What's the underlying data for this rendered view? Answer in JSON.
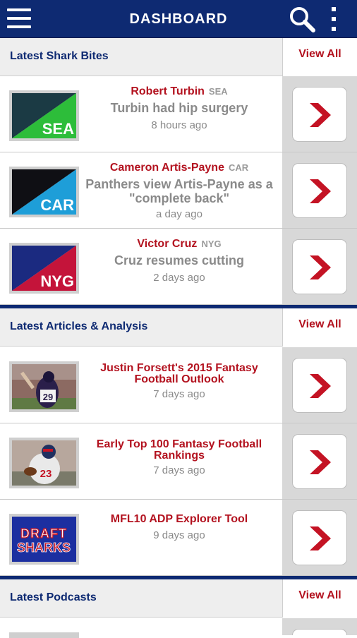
{
  "header": {
    "title": "DASHBOARD",
    "icons": [
      "hamburger-menu-icon",
      "search-icon",
      "more-vert-icon"
    ],
    "background_color": "#0e2a72"
  },
  "colors": {
    "accent": "#b3121f",
    "brand": "#0e2a72",
    "muted": "#8a8a8a"
  },
  "shark_bites": {
    "title": "Latest Shark Bites",
    "view_all": "View All",
    "items": [
      {
        "name": "Robert Turbin",
        "team": "SEA",
        "headline": "Turbin had hip surgery",
        "time": "8 hours ago",
        "logo": {
          "label": "SEA",
          "color_top": "#1b3a44",
          "color_bottom": "#2dbd3a"
        }
      },
      {
        "name": "Cameron Artis-Payne",
        "team": "CAR",
        "headline": "Panthers view Artis-Payne as a \"complete back\"",
        "time": "a day ago",
        "logo": {
          "label": "CAR",
          "color_top": "#0f0f14",
          "color_bottom": "#1e9ed8"
        }
      },
      {
        "name": "Victor Cruz",
        "team": "NYG",
        "headline": "Cruz resumes cutting",
        "time": "2 days ago",
        "logo": {
          "label": "NYG",
          "color_top": "#1b2a80",
          "color_bottom": "#c4143a"
        }
      }
    ]
  },
  "articles": {
    "title": "Latest Articles & Analysis",
    "view_all": "View All",
    "items": [
      {
        "title": "Justin Forsett's 2015 Fantasy Football Outlook",
        "time": "7 days ago",
        "thumb": "football-player-photo"
      },
      {
        "title": "Early Top 100 Fantasy Football Rankings",
        "time": "7 days ago",
        "thumb": "football-player-photo"
      },
      {
        "title": "MFL10 ADP Explorer Tool",
        "time": "9 days ago",
        "thumb": "draft-sharks-logo",
        "logo_text_top": "DRAFT",
        "logo_text_bottom": "SHARKS"
      }
    ]
  },
  "podcasts": {
    "title": "Latest Podcasts",
    "view_all": "View All"
  }
}
